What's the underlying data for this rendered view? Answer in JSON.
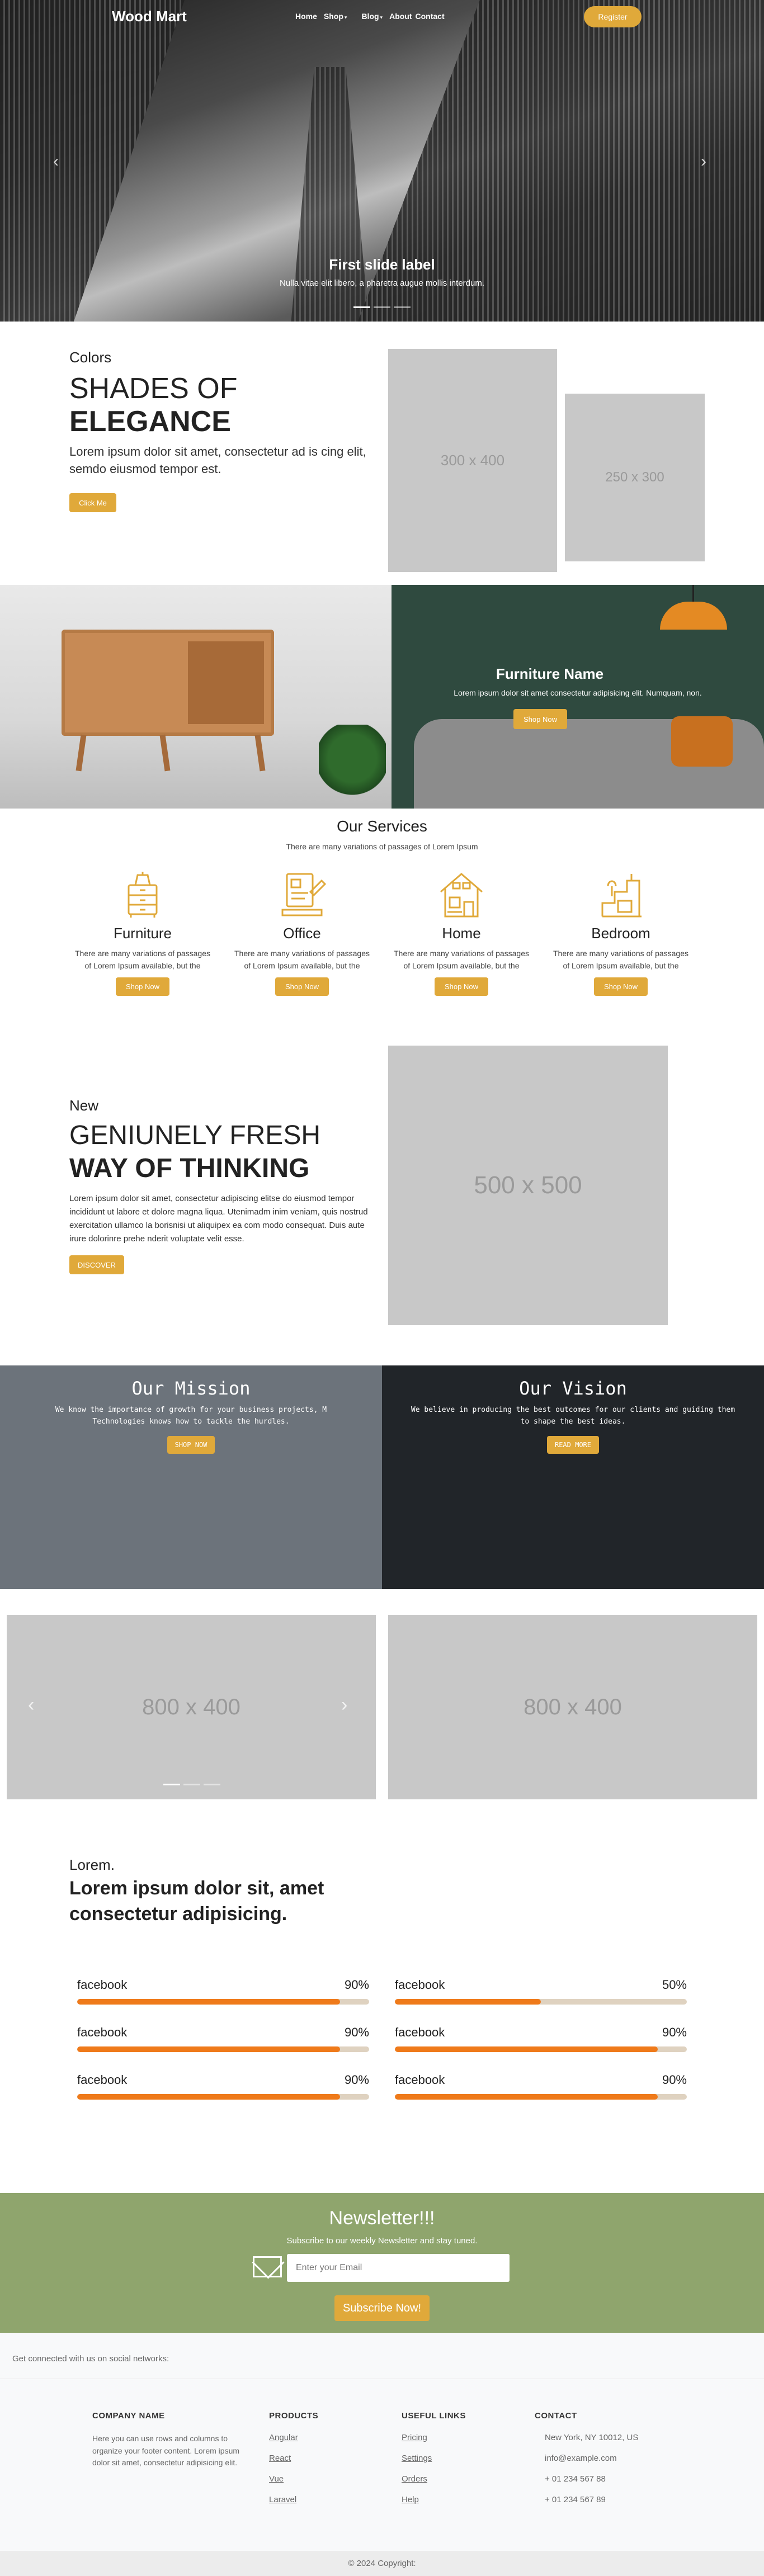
{
  "nav": {
    "brand": "Wood Mart",
    "links": [
      "Home",
      "Shop",
      "Blog",
      "About",
      "Contact"
    ],
    "register": "Register"
  },
  "hero": {
    "title": "First slide label",
    "subtitle": "Nulla vitae elit libero, a pharetra augue mollis interdum.",
    "prev_icon": "chevron-left-icon",
    "next_icon": "chevron-right-icon"
  },
  "colors_section": {
    "eyebrow": "Colors",
    "line1": "SHADES OF",
    "line2": "ELEGANCE",
    "text": "Lorem ipsum dolor sit amet, consectetur ad is cing elit, semdo eiusmod tempor est.",
    "button": "Click Me",
    "img1": "300 x 400",
    "img2": "250 x 300"
  },
  "furniture_banner": {
    "title": "Furniture Name",
    "subtitle": "Lorem ipsum dolor sit amet consectetur adipisicing elit. Numquam, non.",
    "button": "Shop Now"
  },
  "services": {
    "title": "Our Services",
    "subtitle": "There are many variations of passages of Lorem Ipsum",
    "items": [
      {
        "name": "Furniture",
        "desc": "There are many variations of passages of Lorem Ipsum available, but the",
        "button": "Shop Now"
      },
      {
        "name": "Office",
        "desc": "There are many variations of passages of Lorem Ipsum available, but the",
        "button": "Shop Now"
      },
      {
        "name": "Home",
        "desc": "There are many variations of passages of Lorem Ipsum available, but the",
        "button": "Shop Now"
      },
      {
        "name": "Bedroom",
        "desc": "There are many variations of passages of Lorem Ipsum available, but the",
        "button": "Shop Now"
      }
    ]
  },
  "fresh": {
    "eyebrow": "New",
    "line1": "GENIUNELY FRESH",
    "line2": "WAY OF THINKING",
    "text": "Lorem ipsum dolor sit amet, consectetur adipiscing elitse do eiusmod tempor incididunt ut labore et dolore magna liqua. Utenimadm inim veniam, quis nostrud exercitation ullamco la borisnisi ut aliquipex ea com modo consequat. Duis aute irure dolorinre prehe nderit voluptate velit esse.",
    "button": "DISCOVER",
    "img": "500 x 500"
  },
  "mission": {
    "title": "Our Mission",
    "text": "We know the importance of growth for your business projects, M Technologies knows how to tackle the hurdles.",
    "button": "SHOP NOW"
  },
  "vision": {
    "title": "Our Vision",
    "text": "We believe in producing the best outcomes for our clients and guiding them to shape the best ideas.",
    "button": "READ MORE"
  },
  "gallery": {
    "slider_img": "800 x 400",
    "static_img": "800 x 400"
  },
  "skills": {
    "eyebrow": "Lorem.",
    "title": "Lorem ipsum dolor sit, amet consectetur adipisicing.",
    "items": [
      {
        "label": "facebook",
        "value": "90%",
        "fraction": 0.9
      },
      {
        "label": "facebook",
        "value": "50%",
        "fraction": 0.5
      },
      {
        "label": "facebook",
        "value": "90%",
        "fraction": 0.9
      },
      {
        "label": "facebook",
        "value": "90%",
        "fraction": 0.9
      },
      {
        "label": "facebook",
        "value": "90%",
        "fraction": 0.9
      },
      {
        "label": "facebook",
        "value": "90%",
        "fraction": 0.9
      }
    ]
  },
  "newsletter": {
    "title": "Newsletter!!!",
    "subtitle": "Subscribe to our weekly Newsletter and stay tuned.",
    "placeholder": "Enter your Email",
    "button": "Subscribe Now!"
  },
  "footer": {
    "social": "Get connected with us on social networks:",
    "company_title": "COMPANY NAME",
    "company_text": "Here you can use rows and columns to organize your footer content. Lorem ipsum dolor sit amet, consectetur adipisicing elit.",
    "products_title": "PRODUCTS",
    "products": [
      "Angular",
      "React",
      "Vue",
      "Laravel"
    ],
    "links_title": "USEFUL LINKS",
    "links": [
      "Pricing",
      "Settings",
      "Orders",
      "Help"
    ],
    "contact_title": "CONTACT",
    "contact": [
      "New York, NY 10012, US",
      "info@example.com",
      "+ 01 234 567 88",
      "+ 01 234 567 89"
    ],
    "copyright": "© 2024 Copyright:"
  },
  "colors": {
    "accent": "#e0a93a",
    "progress": "#ef7a1a",
    "newsletter_bg": "#8fa56d",
    "mission_bg": "#6c737b",
    "vision_bg": "#212529"
  }
}
